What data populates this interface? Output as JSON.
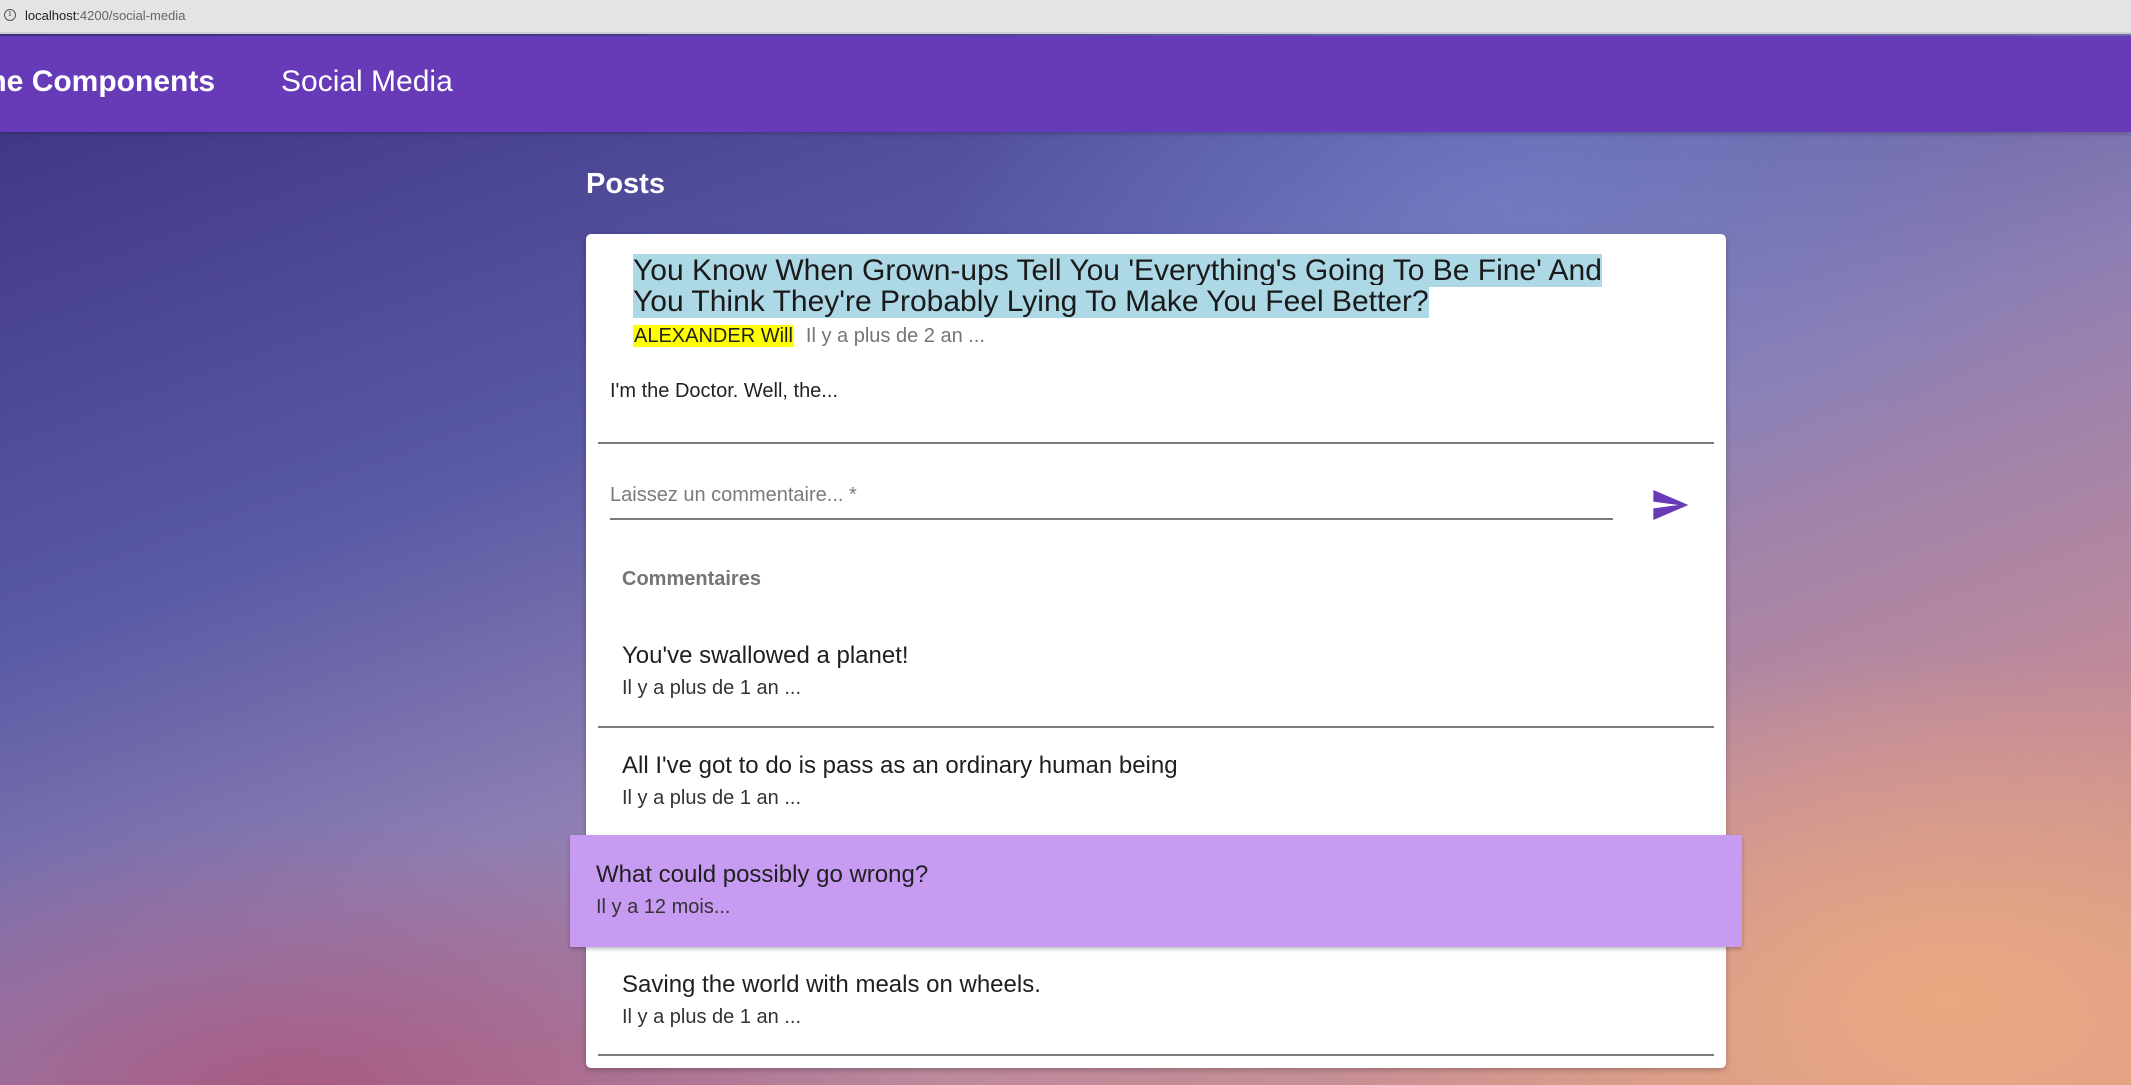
{
  "browser": {
    "url_host": "localhost:",
    "url_path": "4200/social-media"
  },
  "toolbar": {
    "links": [
      "me Components",
      "Social Media"
    ],
    "color": "#673ab7"
  },
  "page": {
    "heading": "Posts"
  },
  "post": {
    "title": "You Know When Grown-ups Tell You 'Everything's Going To Be Fine' And You Think They're Probably Lying To Make You Feel Better?",
    "author": "ALEXANDER Will",
    "date": "Il y a plus de 2 an ...",
    "body": "I'm the Doctor. Well, the...",
    "title_highlight_color": "#add8e6",
    "author_highlight_color": "#ffff00"
  },
  "comment_form": {
    "placeholder": "Laissez un commentaire... *",
    "send_icon": "send-icon"
  },
  "comments": {
    "header": "Commentaires",
    "items": [
      {
        "text": "You've swallowed a planet!",
        "date": "Il y a plus de 1 an ..."
      },
      {
        "text": "All I've got to do is pass as an ordinary human being",
        "date": "Il y a plus de 1 an ..."
      },
      {
        "text": "What could possibly go wrong?",
        "date": "Il y a 12 mois..."
      },
      {
        "text": "Saving the world with meals on wheels.",
        "date": "Il y a plus de 1 an ..."
      }
    ],
    "highlight_color": "#c79bf2"
  }
}
